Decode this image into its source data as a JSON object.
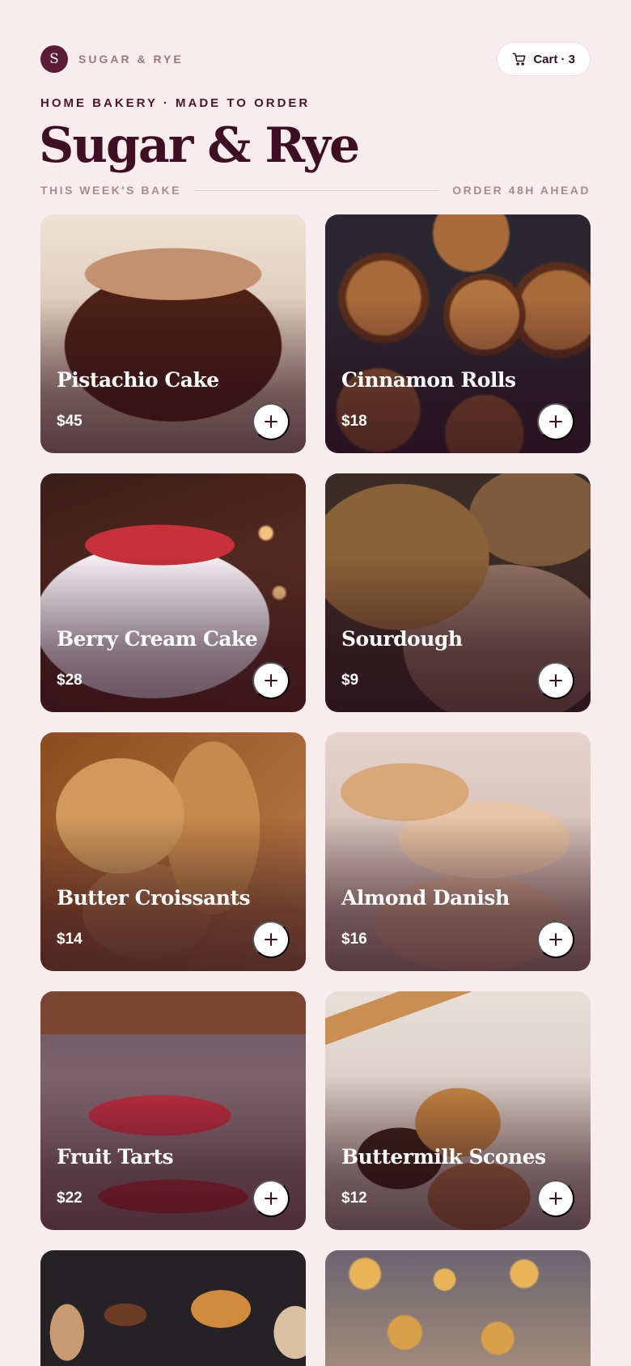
{
  "header": {
    "logo_letter": "S",
    "brand": "SUGAR & RYE",
    "cart_label": "Cart · 3"
  },
  "hero": {
    "eyebrow": "HOME BAKERY · MADE TO ORDER",
    "title": "Sugar & Rye",
    "section_left": "THIS WEEK'S BAKE",
    "section_right": "ORDER 48H AHEAD"
  },
  "products": [
    {
      "name": "Pistachio Cake",
      "price": "$45",
      "photo": "chocolate-drip-cake"
    },
    {
      "name": "Cinnamon Rolls",
      "price": "$18",
      "photo": "cinnamon-rolls"
    },
    {
      "name": "Berry Cream Cake",
      "price": "$28",
      "photo": "berry-cream-cake"
    },
    {
      "name": "Sourdough",
      "price": "$9",
      "photo": "sourdough-loaves"
    },
    {
      "name": "Butter Croissants",
      "price": "$14",
      "photo": "bread-basket"
    },
    {
      "name": "Almond Danish",
      "price": "$16",
      "photo": "pastry-display-case"
    },
    {
      "name": "Fruit Tarts",
      "price": "$22",
      "photo": "fruit-tart-display"
    },
    {
      "name": "Buttermilk Scones",
      "price": "$12",
      "photo": "scones-rolling-pin"
    }
  ],
  "colors": {
    "background": "#f9ecef",
    "brand": "#5b1d36",
    "title": "#3e0f22"
  },
  "icons": {
    "cart": "cart-icon",
    "add": "plus-icon"
  }
}
